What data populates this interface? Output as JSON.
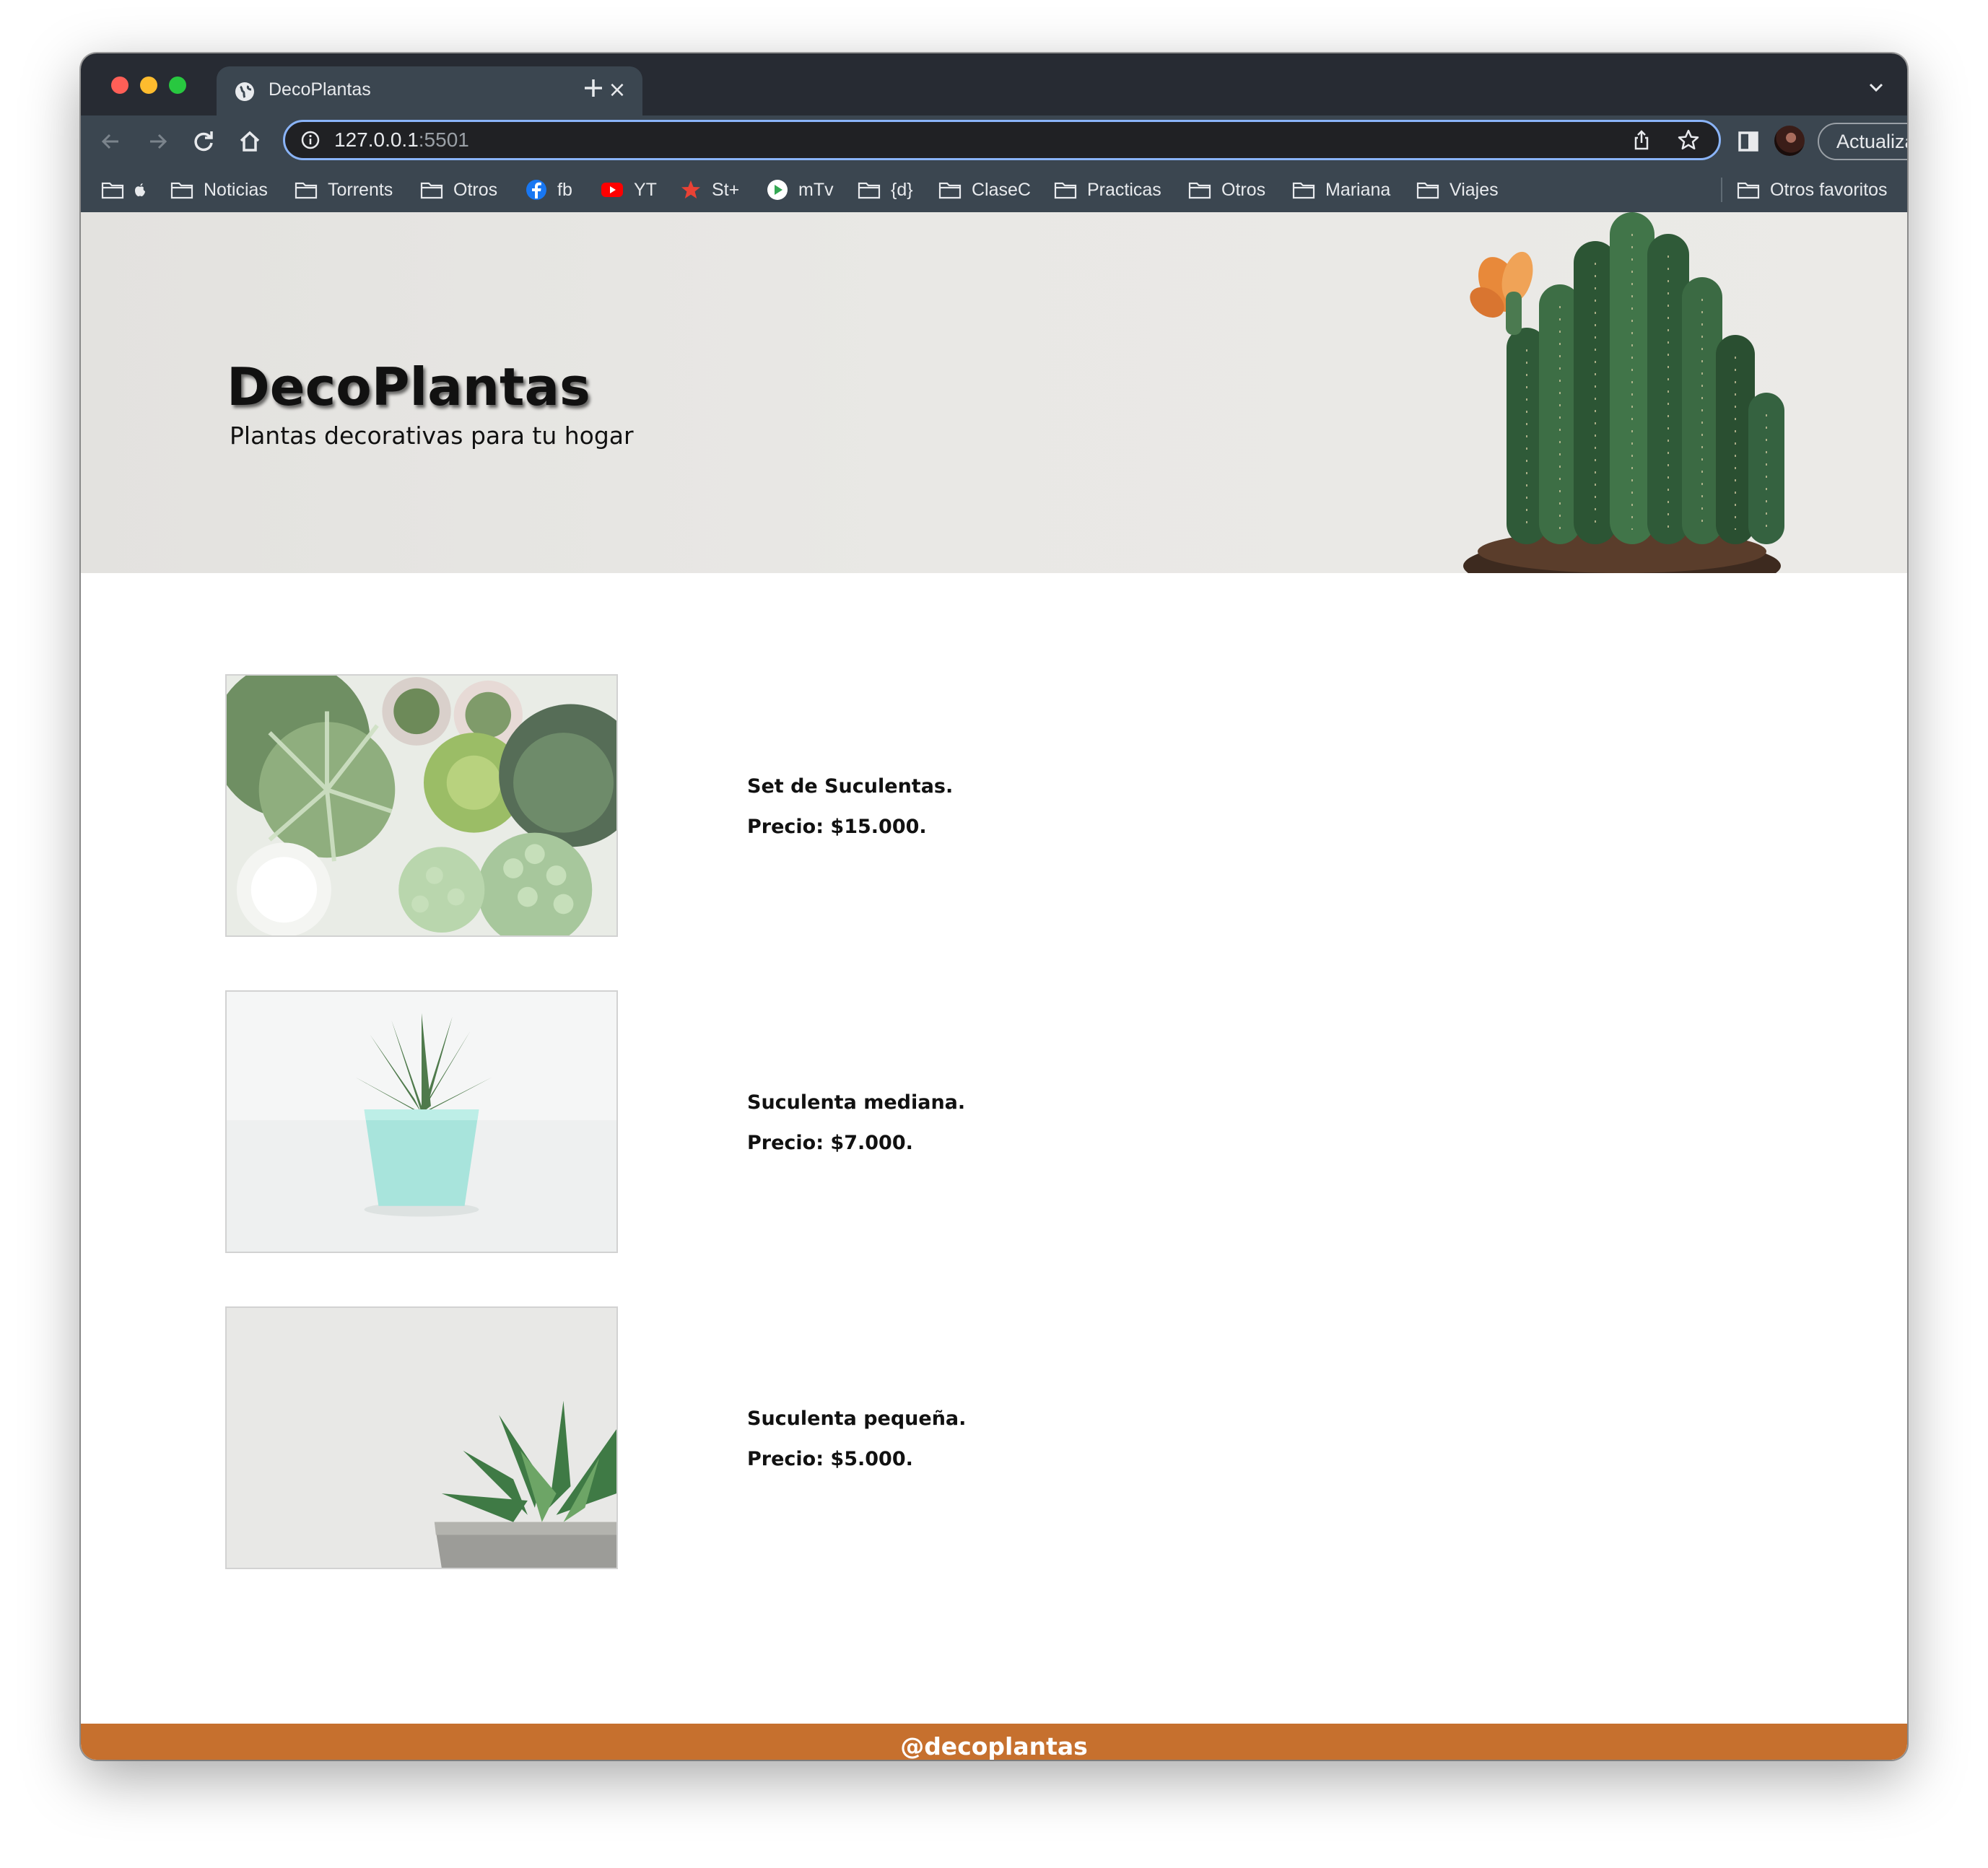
{
  "browser": {
    "tab": {
      "title": "DecoPlantas",
      "favicon": "globe-icon"
    },
    "address_bar": {
      "host": "127.0.0.1",
      "port": ":5501"
    },
    "update_button": "Actualizar",
    "bookmarks": [
      {
        "label": "",
        "icon": "folder-icon"
      },
      {
        "label": "Noticias",
        "icon": "folder-icon"
      },
      {
        "label": "Torrents",
        "icon": "folder-icon"
      },
      {
        "label": "Otros",
        "icon": "folder-icon"
      },
      {
        "label": "fb",
        "icon": "facebook-icon"
      },
      {
        "label": "YT",
        "icon": "youtube-icon"
      },
      {
        "label": "St+",
        "icon": "star-icon"
      },
      {
        "label": "mTv",
        "icon": "play-icon"
      },
      {
        "label": "{d}",
        "icon": "folder-icon"
      },
      {
        "label": "ClaseC",
        "icon": "folder-icon"
      },
      {
        "label": "Practicas",
        "icon": "folder-icon"
      },
      {
        "label": "Otros",
        "icon": "folder-icon"
      },
      {
        "label": "Mariana",
        "icon": "folder-icon"
      },
      {
        "label": "Viajes",
        "icon": "folder-icon"
      }
    ],
    "other_bookmarks": "Otros favoritos"
  },
  "page": {
    "hero": {
      "title": "DecoPlantas",
      "subtitle": "Plantas decorativas para tu hogar"
    },
    "products": [
      {
        "name": "Set de Suculentas.",
        "price": "Precio: $15.000.",
        "image": "succulent-set-photo"
      },
      {
        "name": "Suculenta mediana.",
        "price": "Precio: $7.000.",
        "image": "medium-succulent-photo"
      },
      {
        "name": "Suculenta pequeña.",
        "price": "Precio: $5.000.",
        "image": "small-succulent-photo"
      }
    ],
    "footer": {
      "handle": "@decoplantas"
    }
  },
  "colors": {
    "footer_bg": "#c6702e",
    "chrome_dark": "#272b33",
    "chrome_toolbar": "#3b4650",
    "omnibox_focus": "#8ab4f8"
  }
}
